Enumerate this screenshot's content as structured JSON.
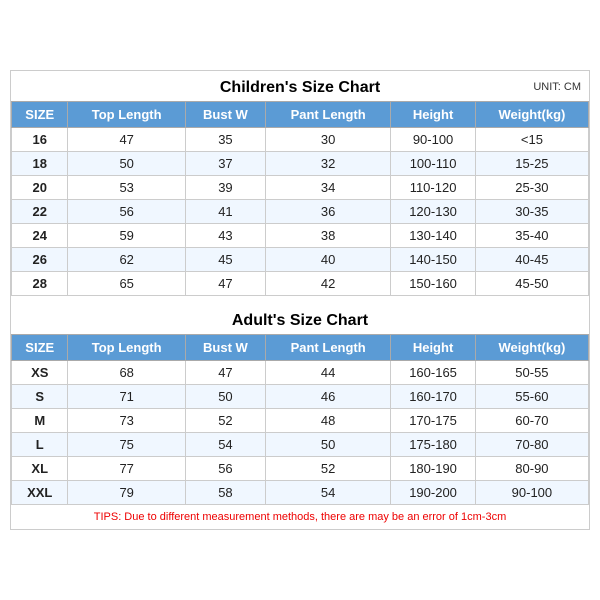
{
  "children_chart": {
    "title": "Children's Size Chart",
    "unit": "UNIT: CM",
    "headers": [
      "SIZE",
      "Top Length",
      "Bust W",
      "Pant Length",
      "Height",
      "Weight(kg)"
    ],
    "rows": [
      [
        "16",
        "47",
        "35",
        "30",
        "90-100",
        "<15"
      ],
      [
        "18",
        "50",
        "37",
        "32",
        "100-110",
        "15-25"
      ],
      [
        "20",
        "53",
        "39",
        "34",
        "110-120",
        "25-30"
      ],
      [
        "22",
        "56",
        "41",
        "36",
        "120-130",
        "30-35"
      ],
      [
        "24",
        "59",
        "43",
        "38",
        "130-140",
        "35-40"
      ],
      [
        "26",
        "62",
        "45",
        "40",
        "140-150",
        "40-45"
      ],
      [
        "28",
        "65",
        "47",
        "42",
        "150-160",
        "45-50"
      ]
    ]
  },
  "adults_chart": {
    "title": "Adult's Size Chart",
    "headers": [
      "SIZE",
      "Top Length",
      "Bust W",
      "Pant Length",
      "Height",
      "Weight(kg)"
    ],
    "rows": [
      [
        "XS",
        "68",
        "47",
        "44",
        "160-165",
        "50-55"
      ],
      [
        "S",
        "71",
        "50",
        "46",
        "160-170",
        "55-60"
      ],
      [
        "M",
        "73",
        "52",
        "48",
        "170-175",
        "60-70"
      ],
      [
        "L",
        "75",
        "54",
        "50",
        "175-180",
        "70-80"
      ],
      [
        "XL",
        "77",
        "56",
        "52",
        "180-190",
        "80-90"
      ],
      [
        "XXL",
        "79",
        "58",
        "54",
        "190-200",
        "90-100"
      ]
    ]
  },
  "tips": "TIPS: Due to different measurement methods, there are may be an error of 1cm-3cm"
}
